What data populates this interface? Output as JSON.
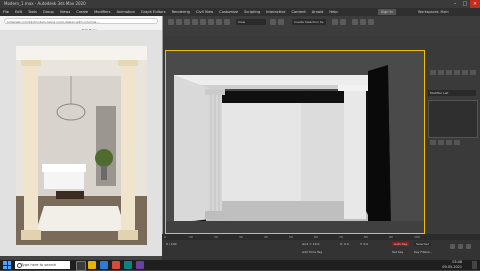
{
  "app": {
    "title": "Modern_1.max - Autodesk 3ds Max 2020",
    "menu": [
      "File",
      "Edit",
      "Tools",
      "Group",
      "Views",
      "Create",
      "Modifiers",
      "Animation",
      "Graph Editors",
      "Rendering",
      "Civil View",
      "Customize",
      "Scripting",
      "Interactive",
      "Content",
      "Arnold",
      "Help"
    ],
    "sign_in": "Sign In",
    "workspace": "Workspaces: Main",
    "scene_select": "Create Selection Se",
    "view_label": "View"
  },
  "browser": {
    "url": "pinterest.com/pin/modern-living-room-design-with-columns-...",
    "tab_label": "Edit Menu"
  },
  "command_panel": {
    "modifier_list": "Modifier List"
  },
  "timeline": {
    "ticks": [
      "0",
      "10",
      "20",
      "30",
      "40",
      "50",
      "60",
      "70",
      "80",
      "90",
      "100"
    ],
    "frame_counter": "0 / 100",
    "auto_key": "Auto Key",
    "set_key": "Set Key",
    "selected": "Selected",
    "key_filters": "Key Filters...",
    "add_time_tag": "Add Time Tag",
    "grid": "Grid = 10.0",
    "coord_x": "X: 0.0",
    "coord_y": "Y: 0.0"
  },
  "taskbar": {
    "search_placeholder": "Type here to search",
    "time": "03:48",
    "date": "09-05-2021"
  },
  "colors": {
    "viewport_border": "#f0c000",
    "accent": "#2e7bd6"
  }
}
